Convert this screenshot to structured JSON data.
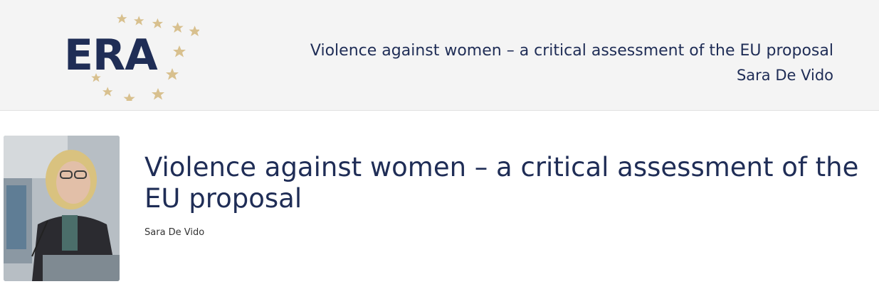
{
  "brand": {
    "logo_text": "ERA",
    "logo_text_color": "#1f2d56",
    "star_color": "#d8c08e",
    "header_background": "#f4f4f4"
  },
  "header": {
    "title": "Violence against women – a critical assessment of the EU proposal",
    "author": "Sara De Vido"
  },
  "main": {
    "thumbnail_icon": "speaker-photo",
    "title": "Violence against women – a critical assessment of the EU proposal",
    "author": "Sara De Vido"
  }
}
